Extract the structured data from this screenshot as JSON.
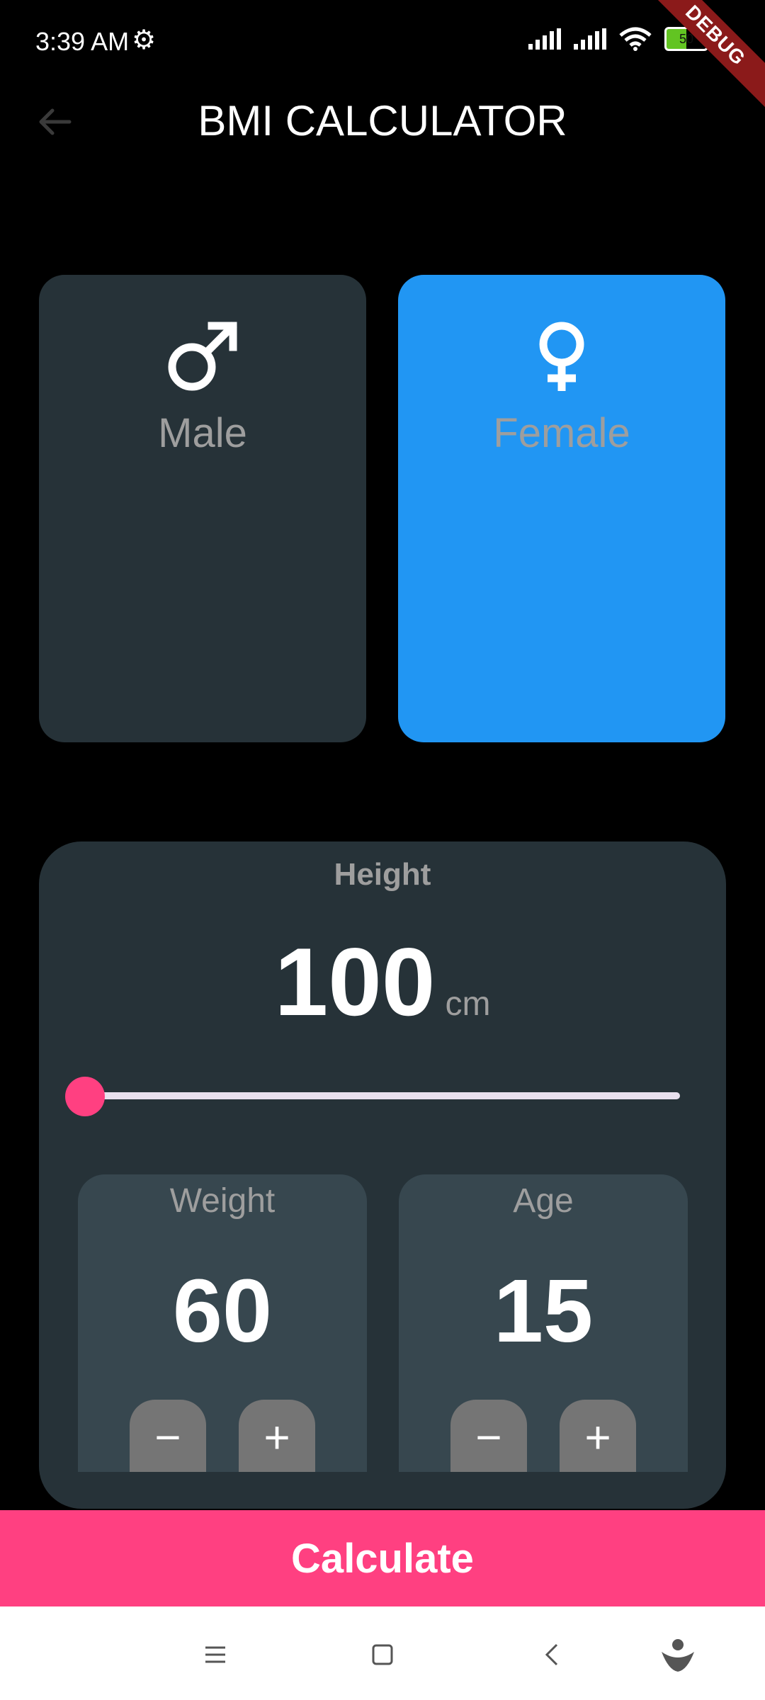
{
  "status_bar": {
    "time": "3:39 AM",
    "battery": "50",
    "debug": "DEBUG"
  },
  "app_bar": {
    "title": "BMI CALCULATOR",
    "back_icon": "arrow-left-icon"
  },
  "gender": {
    "male": {
      "label": "Male",
      "icon": "male-symbol-icon",
      "selected": false
    },
    "female": {
      "label": "Female",
      "icon": "female-symbol-icon",
      "selected": true
    }
  },
  "height": {
    "title": "Height",
    "value": "100",
    "unit": "cm",
    "slider_fraction": 0.0
  },
  "weight": {
    "label": "Weight",
    "value": "60",
    "minus": "−",
    "plus": "+"
  },
  "age": {
    "label": "Age",
    "value": "15",
    "minus": "−",
    "plus": "+"
  },
  "calculate": {
    "label": "Calculate"
  },
  "colors": {
    "background": "#000000",
    "card": "#263238",
    "selected_card": "#2196f3",
    "inner_card": "#37474f",
    "accent": "#ff4081",
    "label_gray": "#9e9e9e"
  },
  "nav": {
    "menu_icon": "menu-icon",
    "home_icon": "home-square-icon",
    "back_icon": "back-chevron-icon",
    "assistant_icon": "assistant-icon"
  }
}
